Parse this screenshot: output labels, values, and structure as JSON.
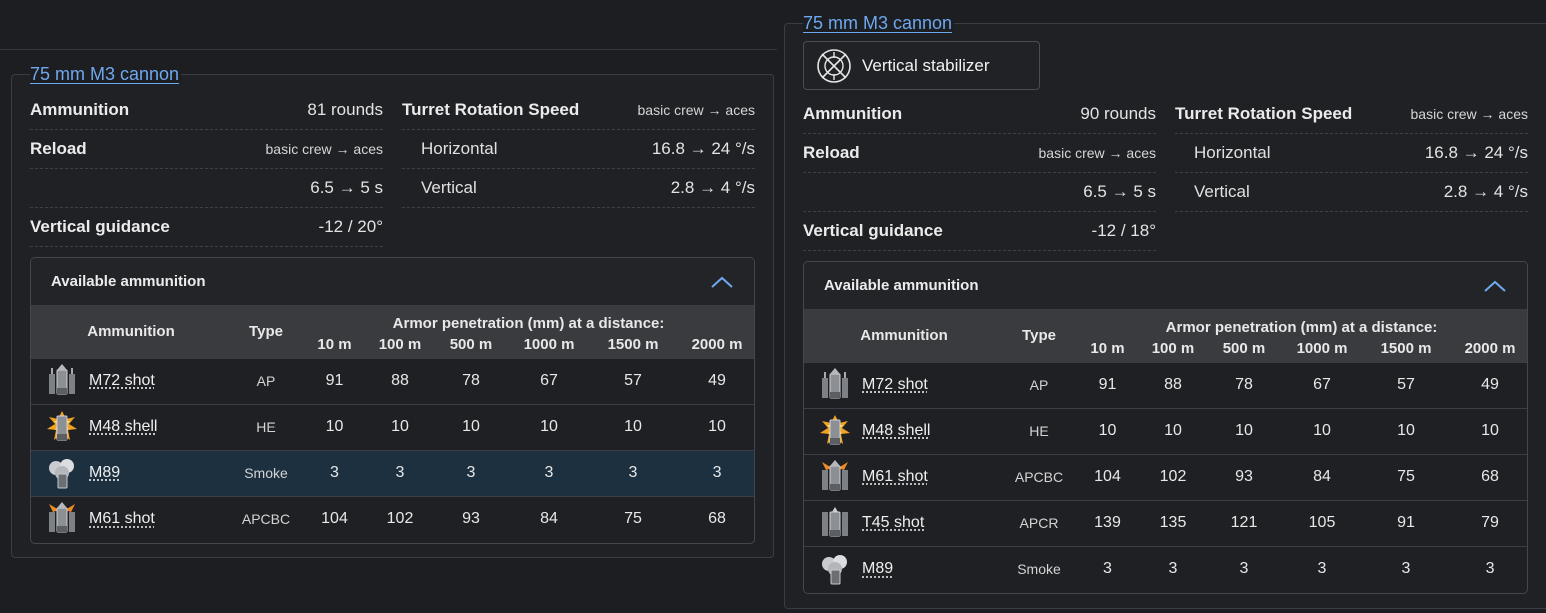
{
  "left": {
    "title": "75 mm M3 cannon",
    "stats_left": [
      {
        "label": "Ammunition",
        "value": "81 rounds",
        "small": false,
        "sub": false
      },
      {
        "label": "Reload",
        "value": "basic crew → aces",
        "small": true,
        "sub": false
      },
      {
        "label": "",
        "value": "6.5 → 5 s",
        "small": false,
        "sub": false
      },
      {
        "label": "Vertical guidance",
        "value": "-12 / 20°",
        "small": false,
        "sub": false
      }
    ],
    "stats_right": [
      {
        "label": "Turret Rotation Speed",
        "value": "basic crew → aces",
        "small": true,
        "sub": false
      },
      {
        "label": "Horizontal",
        "value": "16.8 → 24 °/s",
        "small": false,
        "sub": true
      },
      {
        "label": "Vertical",
        "value": "2.8 → 4 °/s",
        "small": false,
        "sub": true
      }
    ],
    "ammo_title": "Available ammunition",
    "header": {
      "ammo": "Ammunition",
      "type": "Type",
      "pen": "Armor penetration (mm) at a distance:",
      "dists": [
        "10 m",
        "100 m",
        "500 m",
        "1000 m",
        "1500 m",
        "2000 m"
      ]
    },
    "rows": [
      {
        "name": "M72 shot",
        "type": "AP",
        "pen": [
          "91",
          "88",
          "78",
          "67",
          "57",
          "49"
        ],
        "icon": "ap-shell-icon",
        "highlight": false
      },
      {
        "name": "M48 shell",
        "type": "HE",
        "pen": [
          "10",
          "10",
          "10",
          "10",
          "10",
          "10"
        ],
        "icon": "he-shell-icon",
        "highlight": false
      },
      {
        "name": "M89",
        "type": "Smoke",
        "pen": [
          "3",
          "3",
          "3",
          "3",
          "3",
          "3"
        ],
        "icon": "smoke-shell-icon",
        "highlight": true
      },
      {
        "name": "M61 shot",
        "type": "APCBC",
        "pen": [
          "104",
          "102",
          "93",
          "84",
          "75",
          "68"
        ],
        "icon": "apcbc-shell-icon",
        "highlight": false
      }
    ]
  },
  "right": {
    "title": "75 mm M3 cannon",
    "stabilizer": "Vertical stabilizer",
    "stats_left": [
      {
        "label": "Ammunition",
        "value": "90 rounds",
        "small": false,
        "sub": false
      },
      {
        "label": "Reload",
        "value": "basic crew → aces",
        "small": true,
        "sub": false
      },
      {
        "label": "",
        "value": "6.5 → 5 s",
        "small": false,
        "sub": false
      },
      {
        "label": "Vertical guidance",
        "value": "-12 / 18°",
        "small": false,
        "sub": false
      }
    ],
    "stats_right": [
      {
        "label": "Turret Rotation Speed",
        "value": "basic crew → aces",
        "small": true,
        "sub": false
      },
      {
        "label": "Horizontal",
        "value": "16.8 → 24 °/s",
        "small": false,
        "sub": true
      },
      {
        "label": "Vertical",
        "value": "2.8 → 4 °/s",
        "small": false,
        "sub": true
      }
    ],
    "ammo_title": "Available ammunition",
    "header": {
      "ammo": "Ammunition",
      "type": "Type",
      "pen": "Armor penetration (mm) at a distance:",
      "dists": [
        "10 m",
        "100 m",
        "500 m",
        "1000 m",
        "1500 m",
        "2000 m"
      ]
    },
    "rows": [
      {
        "name": "M72 shot",
        "type": "AP",
        "pen": [
          "91",
          "88",
          "78",
          "67",
          "57",
          "49"
        ],
        "icon": "ap-shell-icon",
        "highlight": false
      },
      {
        "name": "M48 shell",
        "type": "HE",
        "pen": [
          "10",
          "10",
          "10",
          "10",
          "10",
          "10"
        ],
        "icon": "he-shell-icon",
        "highlight": false
      },
      {
        "name": "M61 shot",
        "type": "APCBC",
        "pen": [
          "104",
          "102",
          "93",
          "84",
          "75",
          "68"
        ],
        "icon": "apcbc-shell-icon",
        "highlight": false
      },
      {
        "name": "T45 shot",
        "type": "APCR",
        "pen": [
          "139",
          "135",
          "121",
          "105",
          "91",
          "79"
        ],
        "icon": "apcr-shell-icon",
        "highlight": false
      },
      {
        "name": "M89",
        "type": "Smoke",
        "pen": [
          "3",
          "3",
          "3",
          "3",
          "3",
          "3"
        ],
        "icon": "smoke-shell-icon",
        "highlight": false
      }
    ]
  },
  "colors": {
    "link": "#6ea8ef",
    "highlight_row": "#1c3040",
    "chevron": "#6ea8ef"
  }
}
